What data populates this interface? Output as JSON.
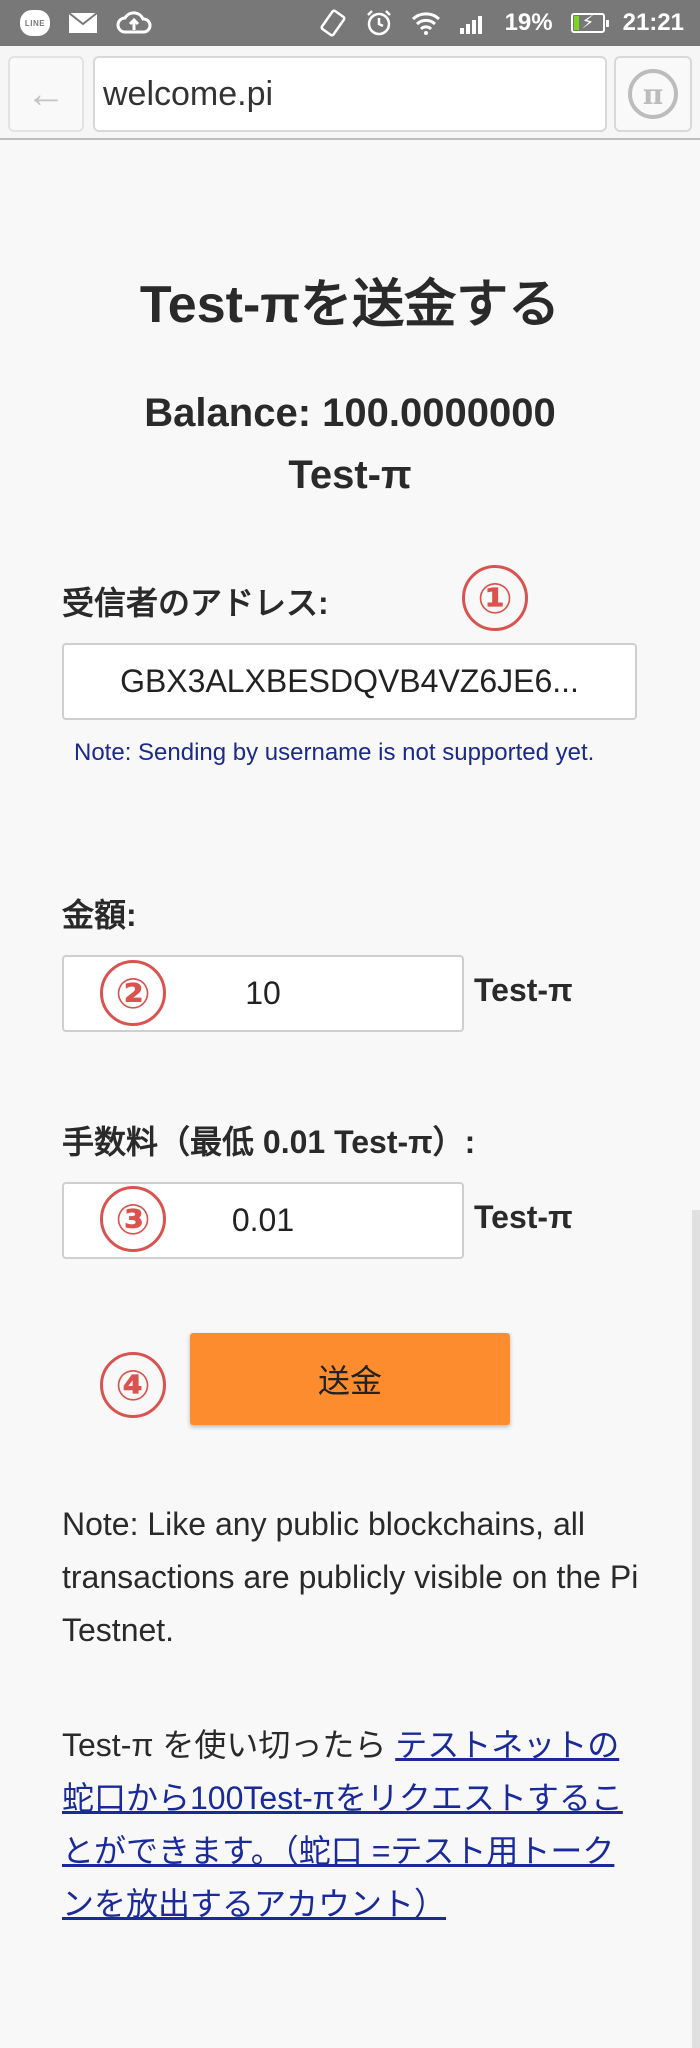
{
  "status_bar": {
    "left_icons": [
      "line-app-icon",
      "mail-icon",
      "cloud-upload-icon"
    ],
    "line_label": "LINE",
    "right_icons": [
      "vibrate-icon",
      "alarm-icon",
      "wifi-icon",
      "signal-icon",
      "battery-charging-icon"
    ],
    "battery_percent": "19%",
    "battery_level": 0.19,
    "time": "21:21"
  },
  "browser": {
    "back_icon": "←",
    "url": "welcome.pi",
    "pi_icon": "π"
  },
  "page": {
    "title": "Test-πを送金する",
    "balance_line1": "Balance: 100.0000000",
    "balance_line2": "Test-π",
    "recipient_label": "受信者のアドレス:",
    "recipient_value": "GBX3ALXBESDQVB4VZ6JE6...",
    "username_note": "Note: Sending by username is not supported yet.",
    "amount_label": "金額:",
    "amount_value": "10",
    "amount_unit": "Test-π",
    "fee_label": "手数料（最低 0.01 Test-π）:",
    "fee_value": "0.01",
    "fee_unit": "Test-π",
    "send_button": "送金",
    "public_note": "Note: Like any public blockchains, all transactions are publicly visible on the Pi Testnet.",
    "faucet_prefix": "Test-π を使い切ったら ",
    "faucet_link": "テストネットの蛇口から100Test-πをリクエストすることができます。（蛇口 =テスト用トークンを放出するアカウント）"
  },
  "markers": [
    "①",
    "②",
    "③",
    "④"
  ],
  "colors": {
    "send_button": "#fd8c2e",
    "marker": "#d9534f",
    "link": "#1a2a9a",
    "note_small": "#1a2a8a"
  }
}
